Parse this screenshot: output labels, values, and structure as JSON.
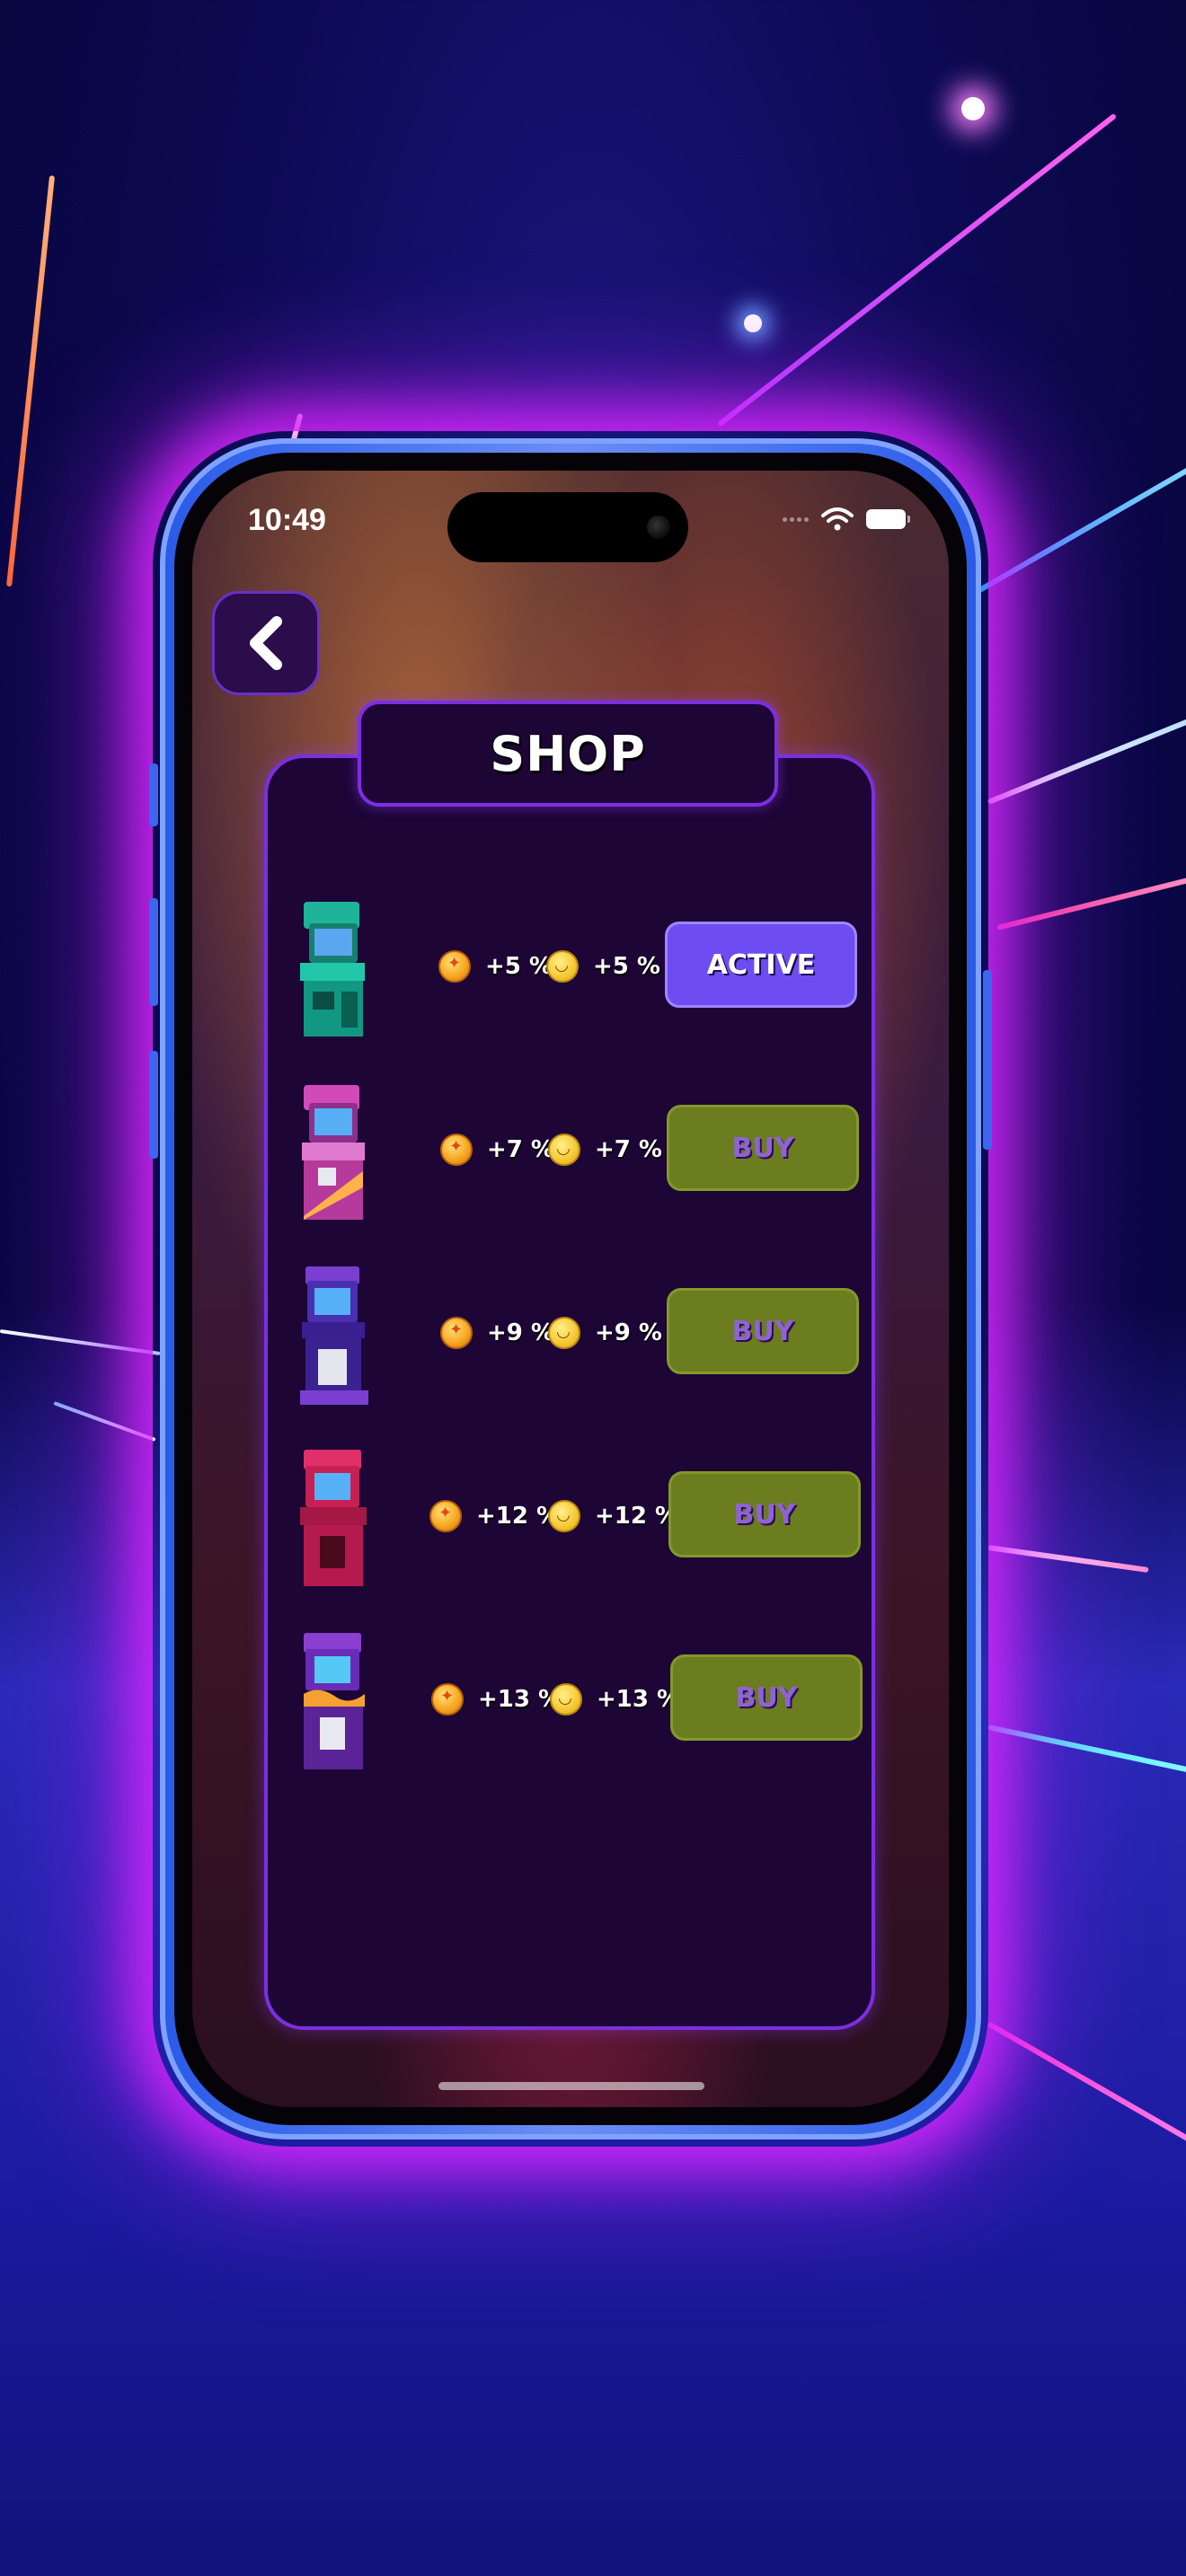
{
  "status_bar": {
    "time": "10:49"
  },
  "header": {
    "title": "SHOP"
  },
  "items": [
    {
      "bonus_coin": "+5 %",
      "bonus_smile": "+5 %",
      "button_label": "ACTIVE",
      "state": "active",
      "machine_color": "#1fb39a"
    },
    {
      "bonus_coin": "+7 %",
      "bonus_smile": "+7 %",
      "button_label": "BUY",
      "state": "buy",
      "machine_color": "#d04bb8"
    },
    {
      "bonus_coin": "+9 %",
      "bonus_smile": "+9 %",
      "button_label": "BUY",
      "state": "buy",
      "machine_color": "#4a2fb0"
    },
    {
      "bonus_coin": "+12 %",
      "bonus_smile": "+12 %",
      "button_label": "BUY",
      "state": "buy",
      "machine_color": "#c81f55"
    },
    {
      "bonus_coin": "+13 %",
      "bonus_smile": "+13 %",
      "button_label": "BUY",
      "state": "buy",
      "machine_color": "#6a2bb8"
    }
  ],
  "colors": {
    "active_button": "#6d4df2",
    "buy_button": "#6b7d1e",
    "panel_bg": "#1d0536",
    "panel_border": "#7c2fe0",
    "phone_glow": "#dc28ff"
  }
}
